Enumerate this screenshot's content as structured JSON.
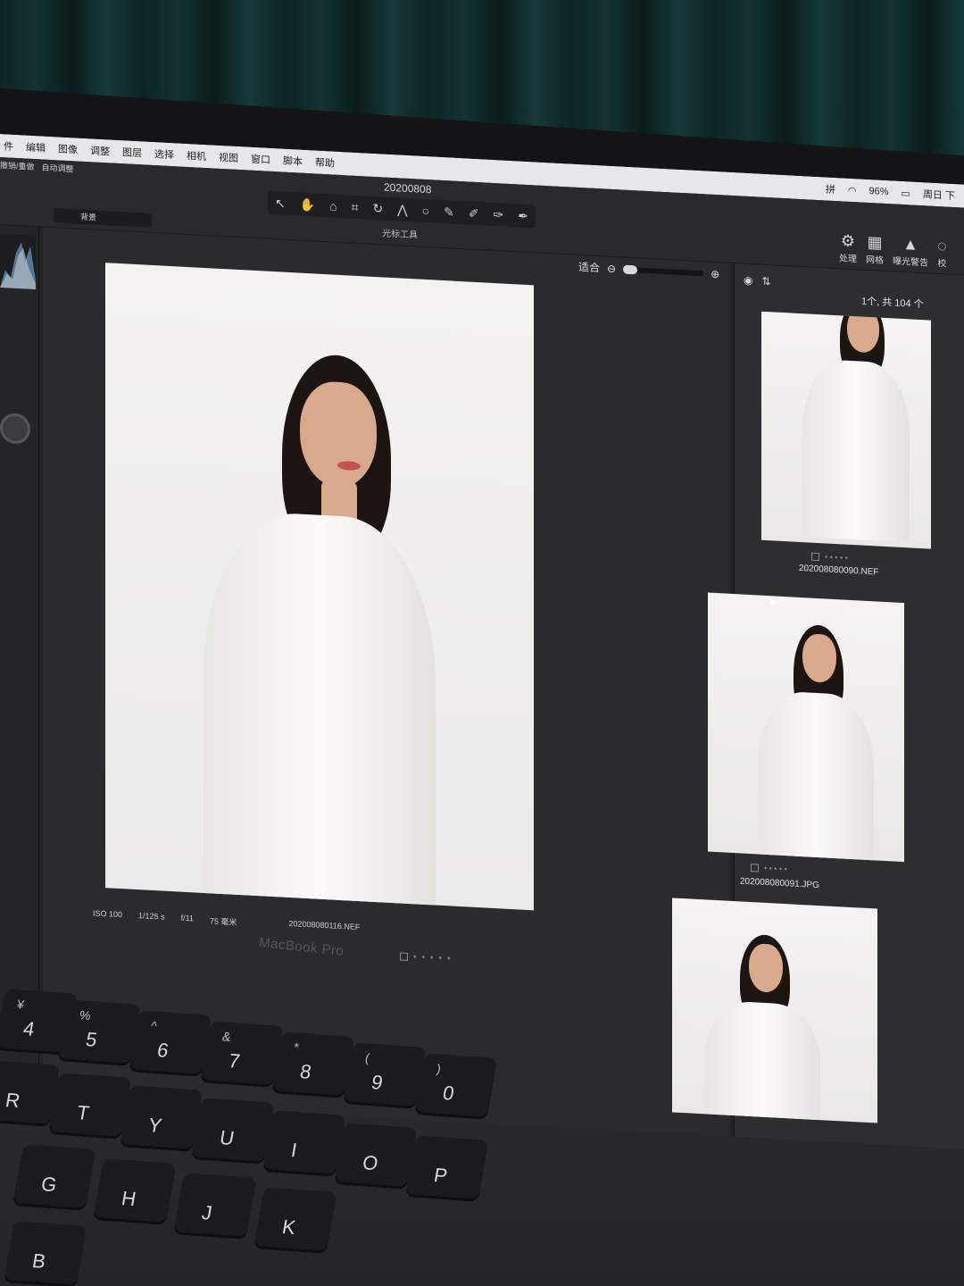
{
  "menubar": {
    "items": [
      "件",
      "编辑",
      "图像",
      "调整",
      "图层",
      "选择",
      "相机",
      "视图",
      "窗口",
      "脚本",
      "帮助"
    ],
    "battery": "96%",
    "clock": "周日 下"
  },
  "toolbar": {
    "document_title": "20200808",
    "left_labels": [
      "撤销/重做",
      "自动调整"
    ],
    "active_tool_caption": "光标工具",
    "preset_select_value": "背景",
    "right_tools": [
      {
        "icon": "gear-icon",
        "label": "处理"
      },
      {
        "icon": "grid-icon",
        "label": "网格"
      },
      {
        "icon": "warning-icon",
        "label": "曝光警告"
      },
      {
        "icon": "check-icon",
        "label": "校"
      }
    ]
  },
  "viewer": {
    "zoom_label": "适合",
    "iso": "ISO 100",
    "shutter": "1/125 s",
    "aperture": "f/11",
    "focal_length": "75 毫米",
    "filename": "202008080116.NEF"
  },
  "browser": {
    "count_label": "1个, 共 104 个",
    "thumbnails": [
      {
        "name": "202008080090.NEF"
      },
      {
        "name": "202008080091.JPG"
      },
      {
        "name": ""
      }
    ]
  },
  "laptop": {
    "brand": "MacBook Pro"
  },
  "keyboard": {
    "keys": [
      {
        "sym": "¥",
        "main": "4"
      },
      {
        "sym": "%",
        "main": "5"
      },
      {
        "sym": "^",
        "main": "6"
      },
      {
        "sym": "&",
        "main": "7"
      },
      {
        "sym": "*",
        "main": "8"
      },
      {
        "sym": "(",
        "main": "9"
      },
      {
        "sym": ")",
        "main": "0"
      },
      {
        "sym": "",
        "main": "R"
      },
      {
        "sym": "",
        "main": "T"
      },
      {
        "sym": "",
        "main": "Y"
      },
      {
        "sym": "",
        "main": "U"
      },
      {
        "sym": "",
        "main": "I"
      },
      {
        "sym": "",
        "main": "O"
      },
      {
        "sym": "",
        "main": "P"
      },
      {
        "sym": "",
        "main": "G"
      },
      {
        "sym": "",
        "main": "H"
      },
      {
        "sym": "",
        "main": "J"
      },
      {
        "sym": "",
        "main": "K"
      },
      {
        "sym": "",
        "main": "B"
      }
    ]
  }
}
